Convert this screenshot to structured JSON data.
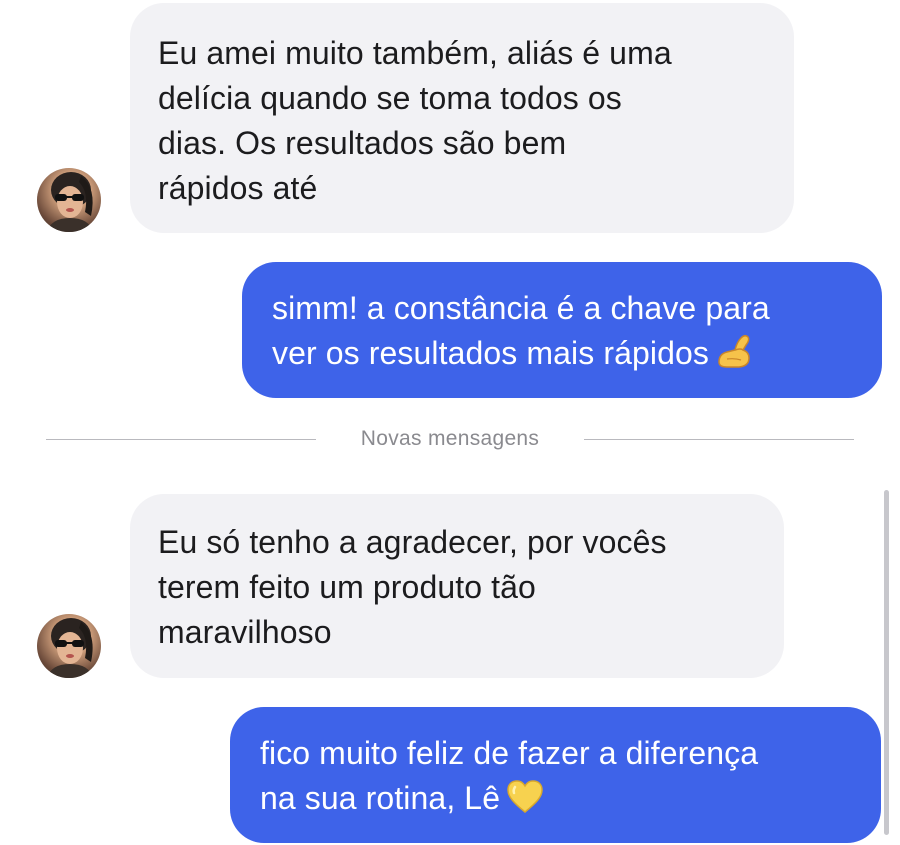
{
  "conversation": {
    "messages": [
      {
        "direction": "incoming",
        "lines": [
          "Eu amei  muito também, aliás é uma",
          "delícia quando se toma todos os",
          "dias. Os resultados são bem",
          "rápidos até"
        ]
      },
      {
        "direction": "outgoing",
        "lines": [
          "simm! a constância é a chave para",
          "ver os resultados mais rápidos"
        ],
        "emoji": "pinching-hand-icon"
      },
      {
        "direction": "incoming",
        "lines": [
          "Eu só tenho a agradecer, por vocês",
          "terem feito um produto tão",
          "maravilhoso"
        ]
      },
      {
        "direction": "outgoing",
        "lines": [
          "fico muito feliz de fazer a diferença",
          "na sua rotina, Lê"
        ],
        "emoji": "yellow-heart-icon"
      }
    ],
    "divider_label": "Novas mensagens"
  },
  "colors": {
    "incoming_bubble": "#f2f2f5",
    "outgoing_bubble": "#3e63e9",
    "divider_text": "#8a8a8f"
  }
}
